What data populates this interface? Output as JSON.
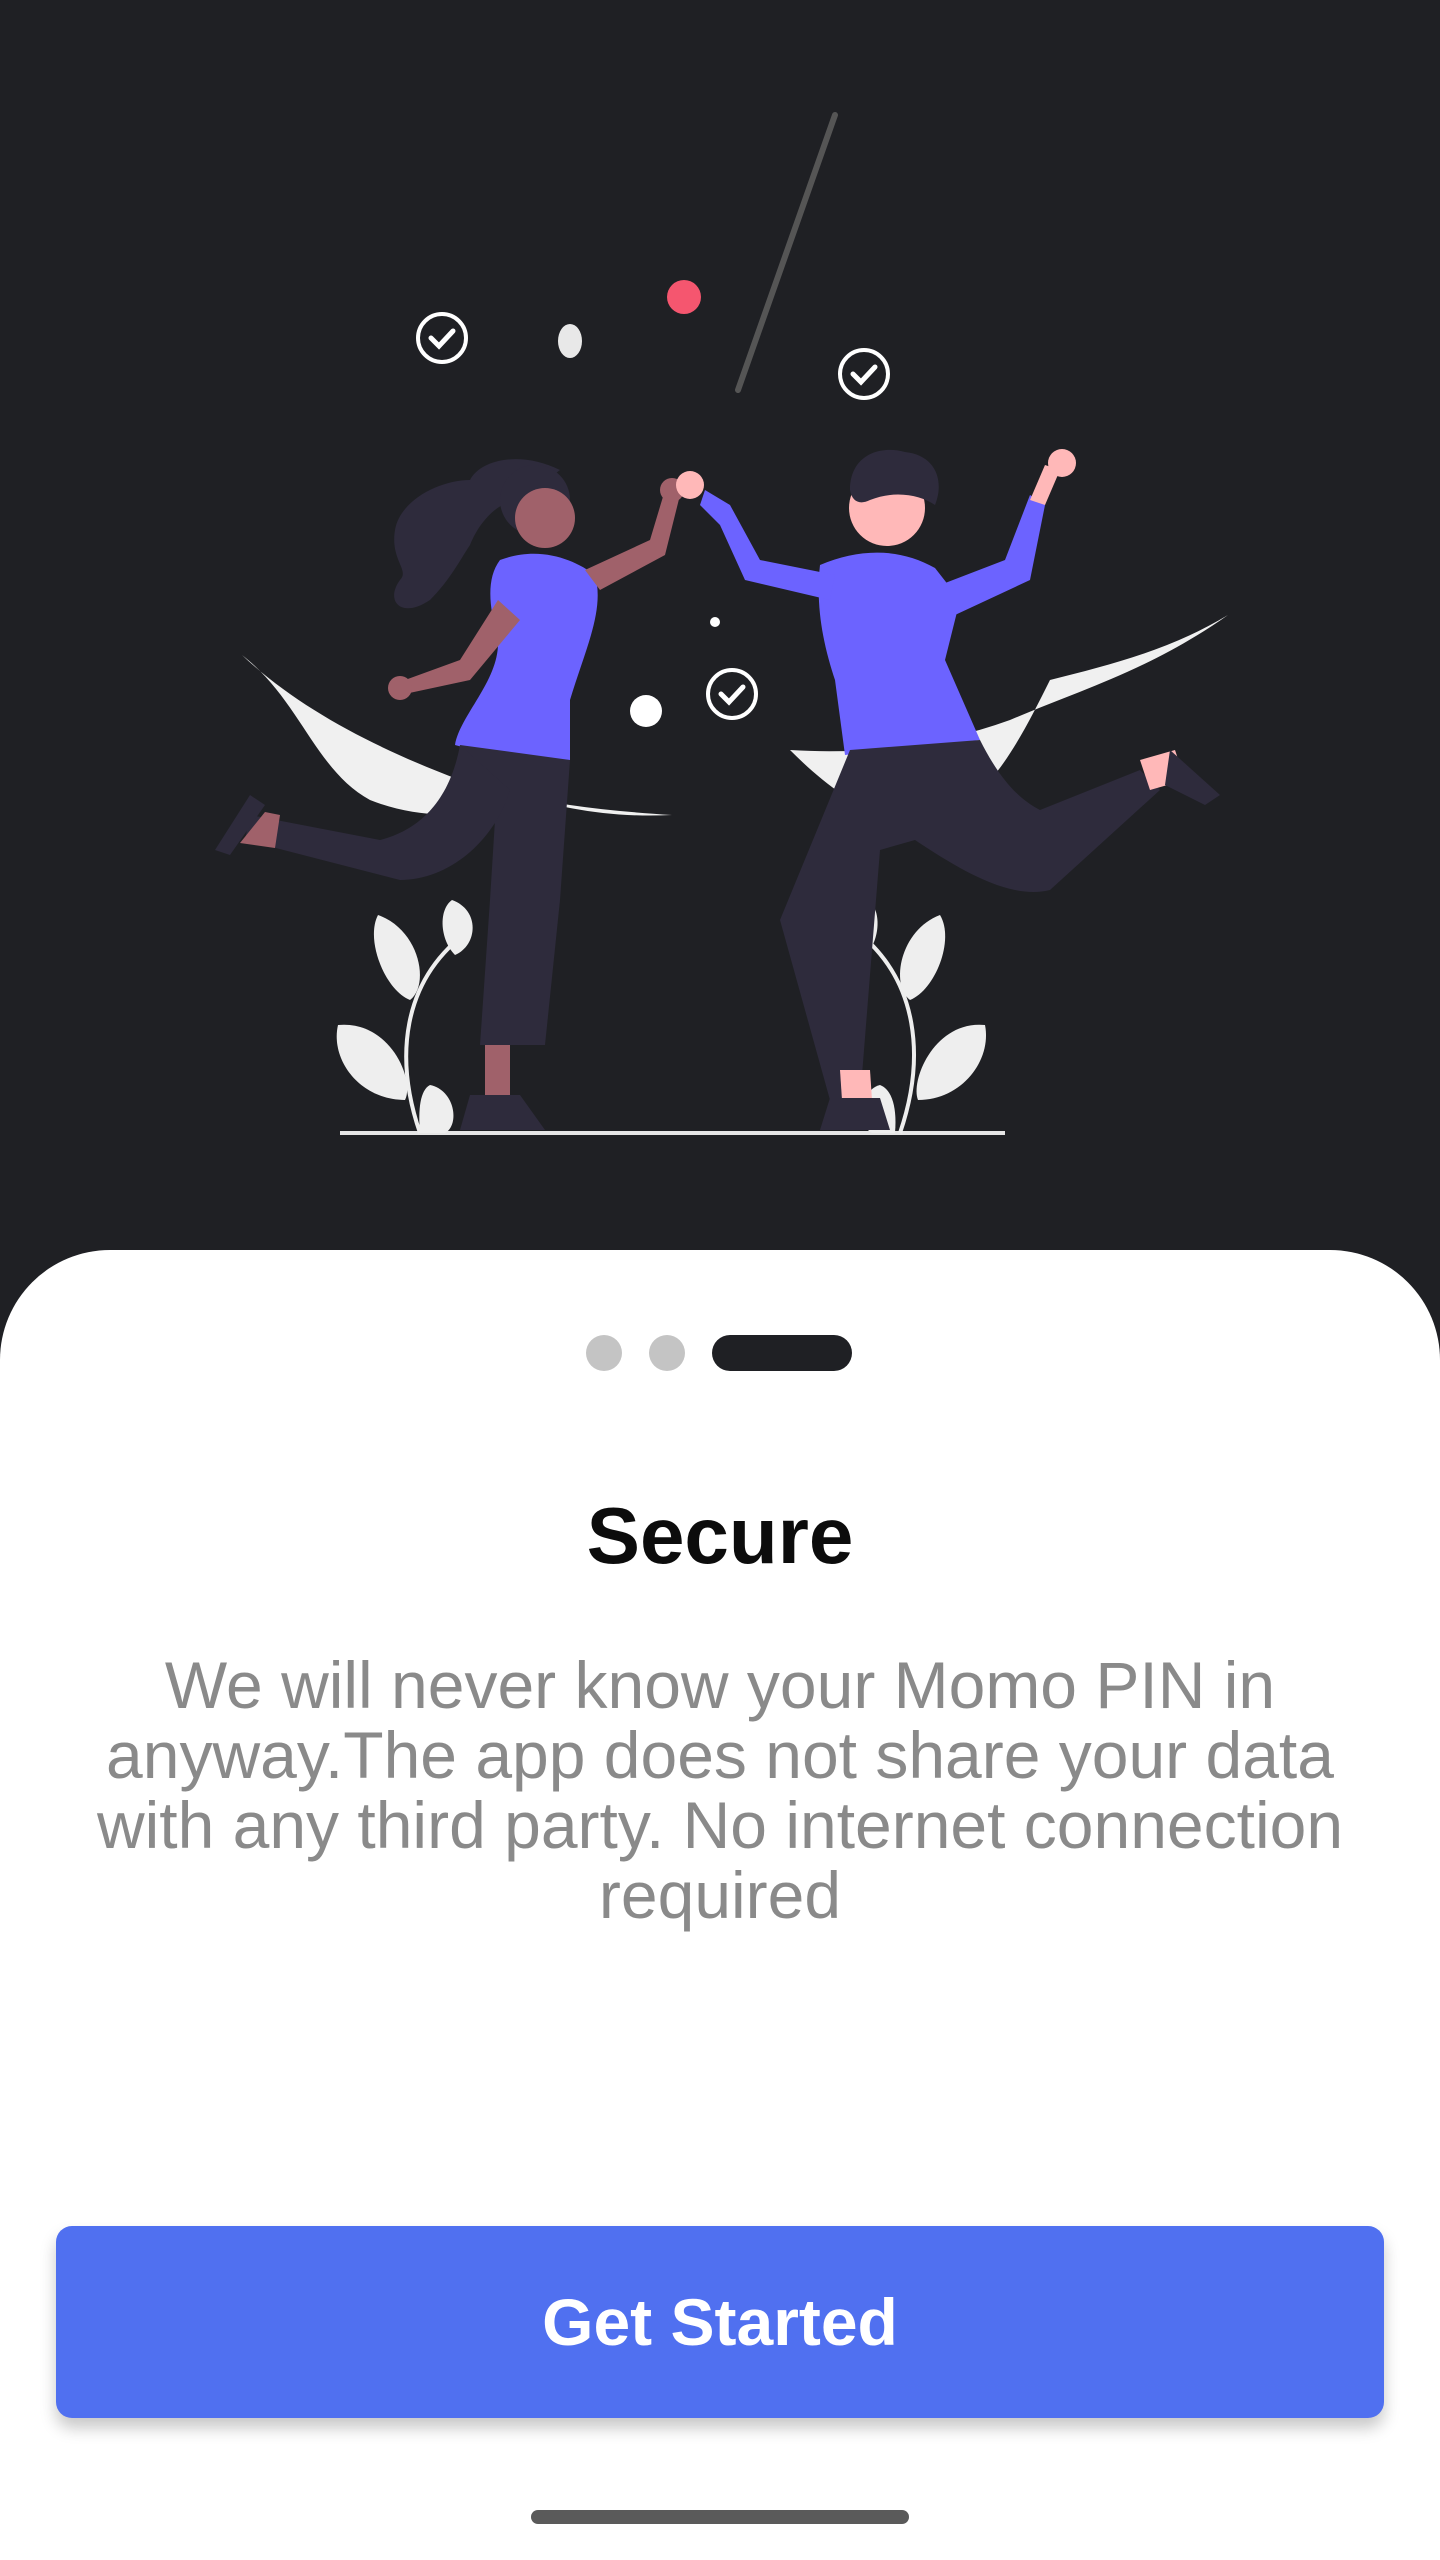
{
  "onboarding": {
    "title": "Secure",
    "description": "We will never know your Momo PIN in anyway.The app does not share your data with any third party. No internet connection required",
    "page_count": 3,
    "active_page": 3,
    "cta_label": "Get Started"
  },
  "colors": {
    "hero_background": "#1f2024",
    "accent": "#5070f0",
    "illustration_purple": "#6c63ff",
    "dot_active": "#1f2024",
    "dot_inactive": "#c4c4c4"
  },
  "icons": [
    "check-circle-icon",
    "dancing-people-illustration"
  ]
}
